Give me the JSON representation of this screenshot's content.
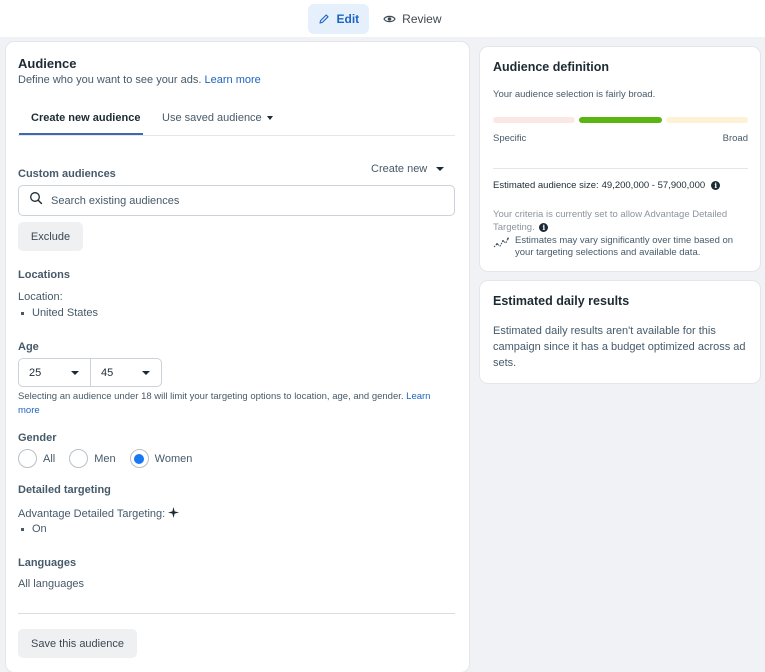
{
  "topbar": {
    "tabs": [
      {
        "label": "Edit",
        "icon": "pencil-icon",
        "active": true
      },
      {
        "label": "Review",
        "icon": "eye-icon",
        "active": false
      }
    ],
    "accent_color": "#1d65c1"
  },
  "audience": {
    "title": "Audience",
    "description": "Define who you want to see your ads.",
    "learn_more": "Learn more",
    "tabs": [
      {
        "label": "Create new audience",
        "active": true
      },
      {
        "label": "Use saved audience",
        "active": false,
        "has_dropdown": true
      }
    ],
    "custom_audiences": {
      "label": "Custom audiences",
      "create_new": "Create new",
      "search_placeholder": "Search existing audiences",
      "search_value": "",
      "exclude_label": "Exclude"
    },
    "locations": {
      "label": "Locations",
      "sub_label": "Location:",
      "items": [
        "United States"
      ]
    },
    "age": {
      "label": "Age",
      "min": "25",
      "max": "45",
      "note": "Selecting an audience under 18 will limit your targeting options to location, age, and gender.",
      "note_link": "Learn more"
    },
    "gender": {
      "label": "Gender",
      "options": [
        {
          "label": "All",
          "checked": false
        },
        {
          "label": "Men",
          "checked": false
        },
        {
          "label": "Women",
          "checked": true
        }
      ]
    },
    "detailed_targeting": {
      "label": "Detailed targeting",
      "sub_label": "Advantage Detailed Targeting:",
      "items": [
        "On"
      ]
    },
    "languages": {
      "label": "Languages",
      "value": "All languages"
    },
    "save_label": "Save this audience"
  },
  "audience_definition": {
    "title": "Audience definition",
    "status": "Your audience selection is fairly broad.",
    "meter": {
      "segments": [
        "specific",
        "fairly broad",
        "broad"
      ],
      "active_segment": 1,
      "colors": [
        "#fbe7e4",
        "#5ab512",
        "#fdf2d6"
      ]
    },
    "scale_left": "Specific",
    "scale_right": "Broad",
    "estimated_size_label": "Estimated audience size:",
    "estimated_size_value": "49,200,000 - 57,900,000",
    "criteria_note": "Your criteria is currently set to allow Advantage Detailed Targeting.",
    "estimate_note": "Estimates may vary significantly over time based on your targeting selections and available data."
  },
  "daily_results": {
    "title": "Estimated daily results",
    "message": "Estimated daily results aren't available for this campaign since it has a budget optimized across ad sets."
  }
}
